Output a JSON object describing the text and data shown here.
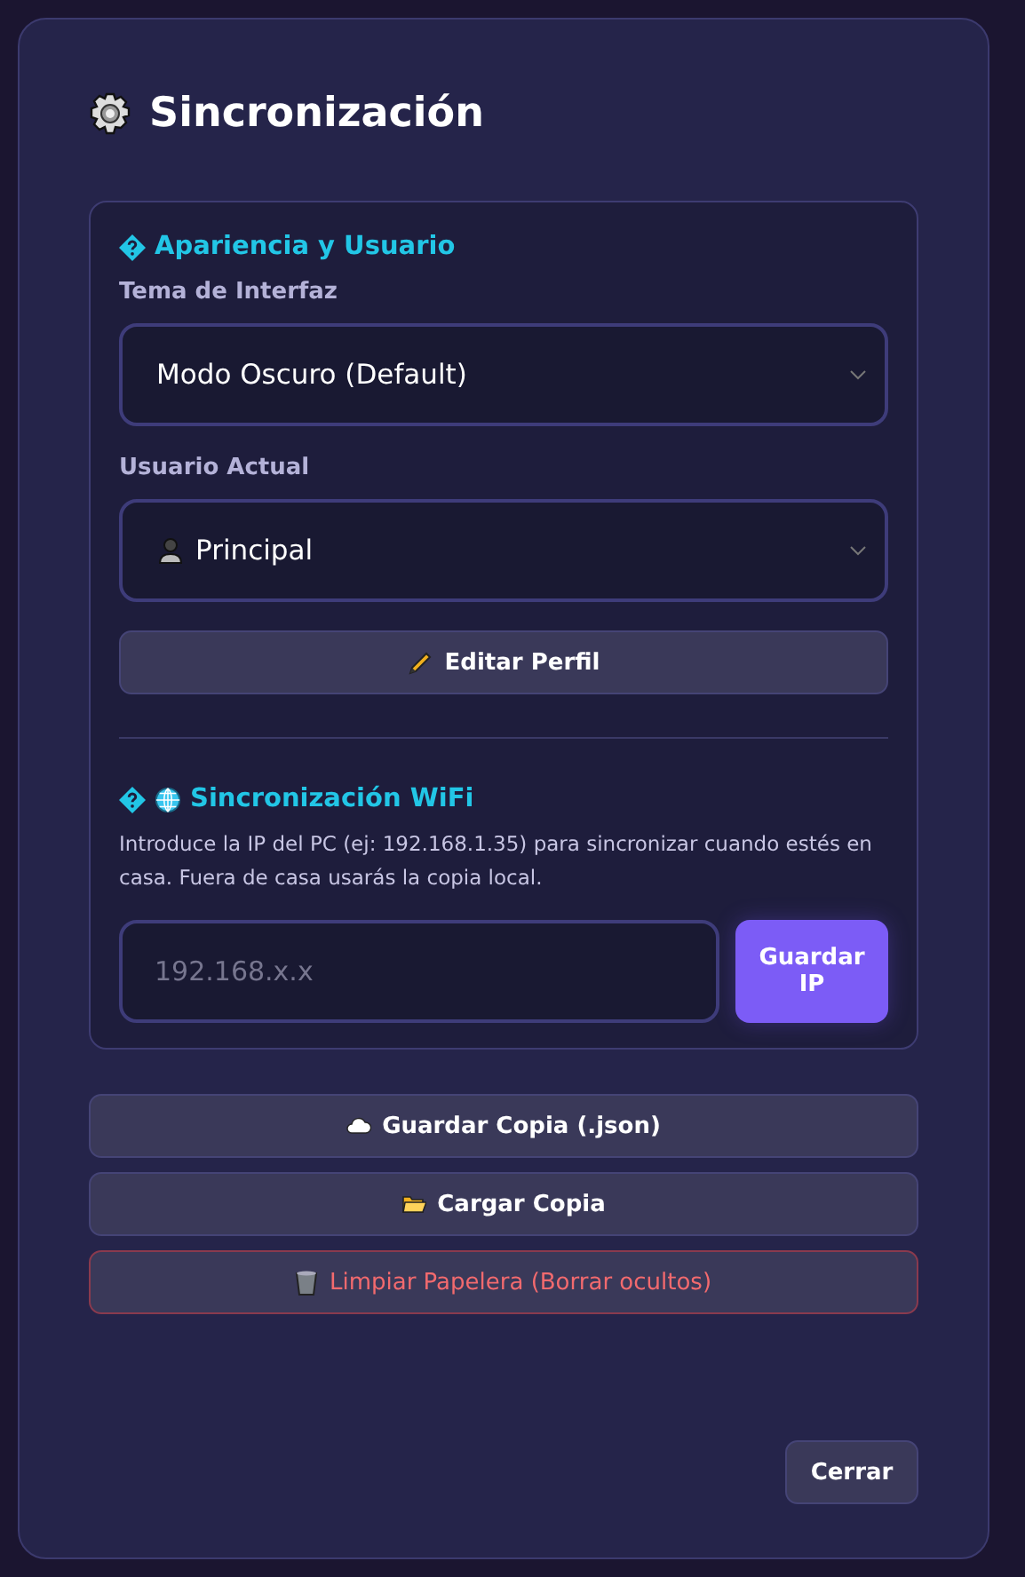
{
  "dialog": {
    "title": "Sincronización"
  },
  "appearance": {
    "heading": "Apariencia y Usuario",
    "theme": {
      "label": "Tema de Interfaz",
      "value": "Modo Oscuro (Default)"
    },
    "user": {
      "label": "Usuario Actual",
      "value": "Principal"
    },
    "edit_button": "Editar Perfil"
  },
  "wifi": {
    "heading": "Sincronización WiFi",
    "description": "Introduce la IP del PC (ej: 192.168.1.35) para sincronizar cuando estés en casa. Fuera de casa usarás la copia local.",
    "ip_field": {
      "placeholder": "192.168.x.x"
    },
    "save_button": "Guardar IP"
  },
  "actions": [
    {
      "kind": "save",
      "label": "Guardar Copia (.json)"
    },
    {
      "kind": "load",
      "label": "Cargar Copia"
    },
    {
      "kind": "danger",
      "label": "Limpiar Papelera (Borrar ocultos)"
    }
  ],
  "close_button": "Cerrar"
}
